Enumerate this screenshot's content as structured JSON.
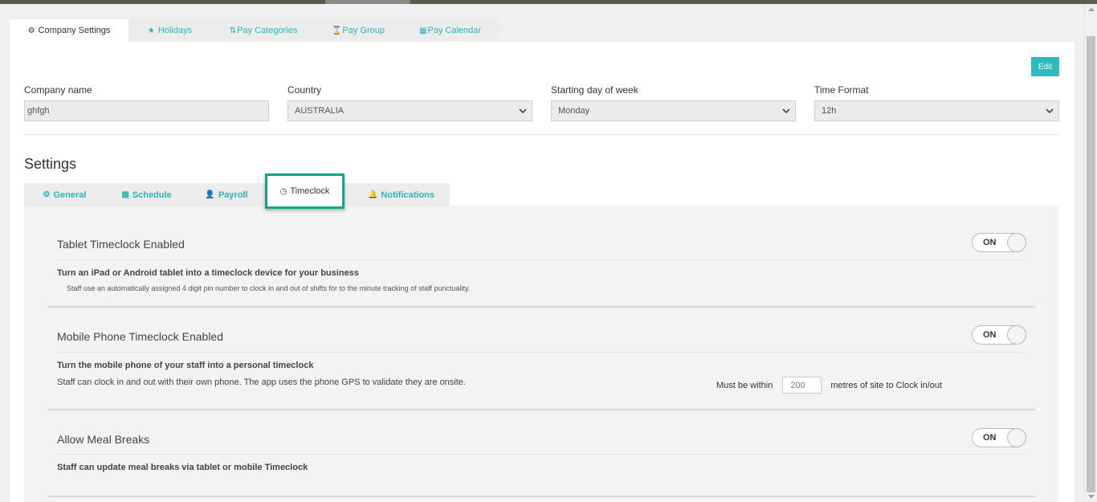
{
  "top_tabs": [
    {
      "label": "Company Settings",
      "icon": "gear-icon",
      "active": true
    },
    {
      "label": "Holidays",
      "icon": "star-icon",
      "active": false
    },
    {
      "label": "Pay Categories",
      "icon": "sort-icon",
      "active": false
    },
    {
      "label": "Pay Group",
      "icon": "hourglass-icon",
      "active": false
    },
    {
      "label": "Pay Calendar",
      "icon": "calendar-icon",
      "active": false
    }
  ],
  "edit_label": "Edit",
  "company": {
    "name_label": "Company name",
    "name_value": "ghfgh",
    "country_label": "Country",
    "country_value": "AUSTRALIA",
    "start_day_label": "Starting day of week",
    "start_day_value": "Monday",
    "time_format_label": "Time Format",
    "time_format_value": "12h"
  },
  "settings_title": "Settings",
  "settings_tabs": [
    {
      "label": "General",
      "icon": "gear-icon",
      "active": false
    },
    {
      "label": "Schedule",
      "icon": "calendar-icon",
      "active": false
    },
    {
      "label": "Payroll",
      "icon": "user-icon",
      "active": false
    },
    {
      "label": "Timeclock",
      "icon": "clock-icon",
      "active": true
    },
    {
      "label": "Notifications",
      "icon": "bell-icon",
      "active": false
    }
  ],
  "sections": {
    "tablet": {
      "heading": "Tablet Timeclock Enabled",
      "toggle": "ON",
      "bold": "Turn an iPad or Android tablet into a timeclock device for your business",
      "desc": "Staff use an automatically assigned 4 digit pin number to clock in and out of shifts for to the minute tracking of staff punctuality."
    },
    "mobile": {
      "heading": "Mobile Phone Timeclock Enabled",
      "toggle": "ON",
      "bold": "Turn the mobile phone of your staff into a personal timeclock",
      "desc": "Staff can clock in and out with their own phone. The app uses the phone GPS to validate they are onsite.",
      "gps_prefix": "Must be within",
      "gps_value": "200",
      "gps_suffix": "metres of site to Clock in/out"
    },
    "meal": {
      "heading": "Allow Meal Breaks",
      "toggle": "ON",
      "bold": "Staff can update meal breaks via tablet or mobile Timeclock"
    }
  },
  "colors": {
    "accent": "#2bb5b9",
    "highlight_border": "#17a58a"
  }
}
